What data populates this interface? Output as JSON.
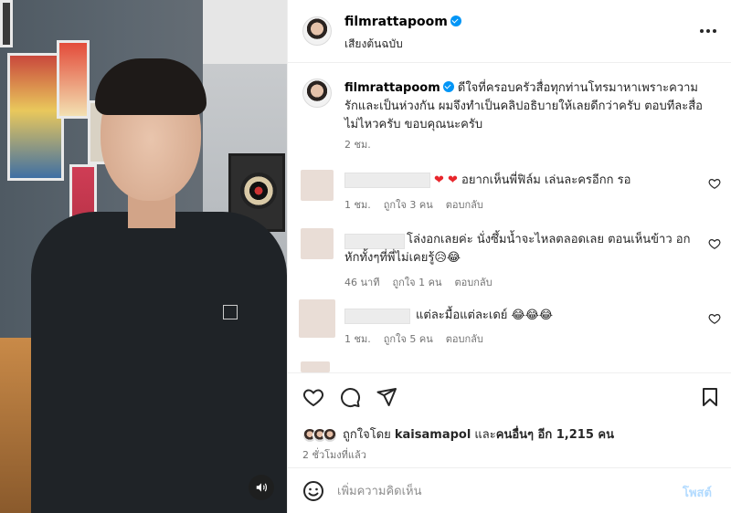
{
  "header": {
    "username": "filmrattapoom",
    "audio_label": "เสียงต้นฉบับ",
    "more_icon": "more-horizontal-icon"
  },
  "caption": {
    "username": "filmrattapoom",
    "text": "ดีใจที่ครอบครัวสื่อทุกท่านโทรมาหาเพราะความรักและเป็นห่วงกัน ผมจึงทำเป็นคลิปอธิบายให้เลยดีกว่าครับ ตอบทีละสื่อไม่ไหวครับ ขอบคุณนะครับ",
    "time": "2 ชม."
  },
  "comments": [
    {
      "text_emoji": "❤ ❤",
      "text": " อยากเห็นพี่ฟิล์ม เล่นละครอีกก รอ",
      "time": "1 ชม.",
      "likes": "ถูกใจ 3 คน",
      "reply": "ตอบกลับ"
    },
    {
      "text": "โล่งอกเลยค่ะ นั่งซึ้มน้ำจะไหลตลอดเลย ตอนเห็นข้าว อกหักทั้งๆที่พี่ไม่เคยรู้😥😂",
      "time": "46 นาที",
      "likes": "ถูกใจ 1 คน",
      "reply": "ตอบกลับ"
    },
    {
      "text": "แต่ละมื้อแต่ละเดย์ 😂😂😂",
      "time": "1 ชม.",
      "likes": "ถูกใจ 5 คน",
      "reply": "ตอบกลับ"
    }
  ],
  "likes": {
    "prefix": "ถูกใจโดย ",
    "user": "kaisamapol",
    "middle": " และ",
    "others": "คนอื่นๆ อีก 1,215 คน"
  },
  "post_time": "2 ชั่วโมงที่แล้ว",
  "comment_box": {
    "placeholder": "เพิ่มความคิดเห็น",
    "post_label": "โพสต์"
  },
  "colors": {
    "verified": "#0095f6",
    "like_red": "#e8262c",
    "post_disabled": "#b3dbff",
    "meta_gray": "#737373"
  }
}
